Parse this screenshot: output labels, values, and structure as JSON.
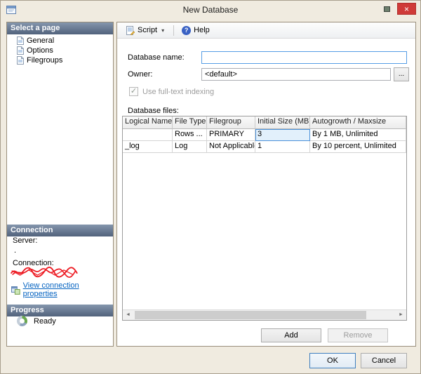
{
  "window": {
    "title": "New Database"
  },
  "icons": {
    "close": "×",
    "dropdown": "▾",
    "scroll_left": "◄",
    "scroll_right": "►",
    "check": "✓",
    "help_glyph": "?"
  },
  "sidebar": {
    "pages": {
      "header": "Select a page",
      "items": [
        {
          "label": "General"
        },
        {
          "label": "Options"
        },
        {
          "label": "Filegroups"
        }
      ]
    },
    "connection": {
      "header": "Connection",
      "server_label": "Server:",
      "server_value": ".",
      "connection_label": "Connection:",
      "link_label": "View connection properties"
    },
    "progress": {
      "header": "Progress",
      "status": "Ready"
    }
  },
  "toolbar": {
    "script_label": "Script",
    "help_label": "Help"
  },
  "form": {
    "database_name_label": "Database name:",
    "database_name_value": "",
    "owner_label": "Owner:",
    "owner_value": "<default>",
    "browse_label": "...",
    "fulltext_label": "Use full-text indexing",
    "files_label": "Database files:"
  },
  "grid": {
    "columns": [
      "Logical Name",
      "File Type",
      "Filegroup",
      "Initial Size (MB)",
      "Autogrowth / Maxsize"
    ],
    "rows": [
      [
        "",
        "Rows ...",
        "PRIMARY",
        "3",
        "By 1 MB, Unlimited"
      ],
      [
        "_log",
        "Log",
        "Not Applicable",
        "1",
        "By 10 percent, Unlimited"
      ]
    ],
    "selected_cell": {
      "row_index": 0,
      "column_index": 3
    }
  },
  "actions": {
    "add": "Add",
    "remove": "Remove"
  },
  "footer": {
    "ok": "OK",
    "cancel": "Cancel"
  },
  "colors": {
    "accent_focus": "#569de5",
    "close_button": "#cf3a38",
    "section_header_top": "#8496ad",
    "section_header_bottom": "#51627c",
    "link": "#0563c1",
    "redaction": "#ed1c24",
    "chrome": "#f0ebe0"
  }
}
